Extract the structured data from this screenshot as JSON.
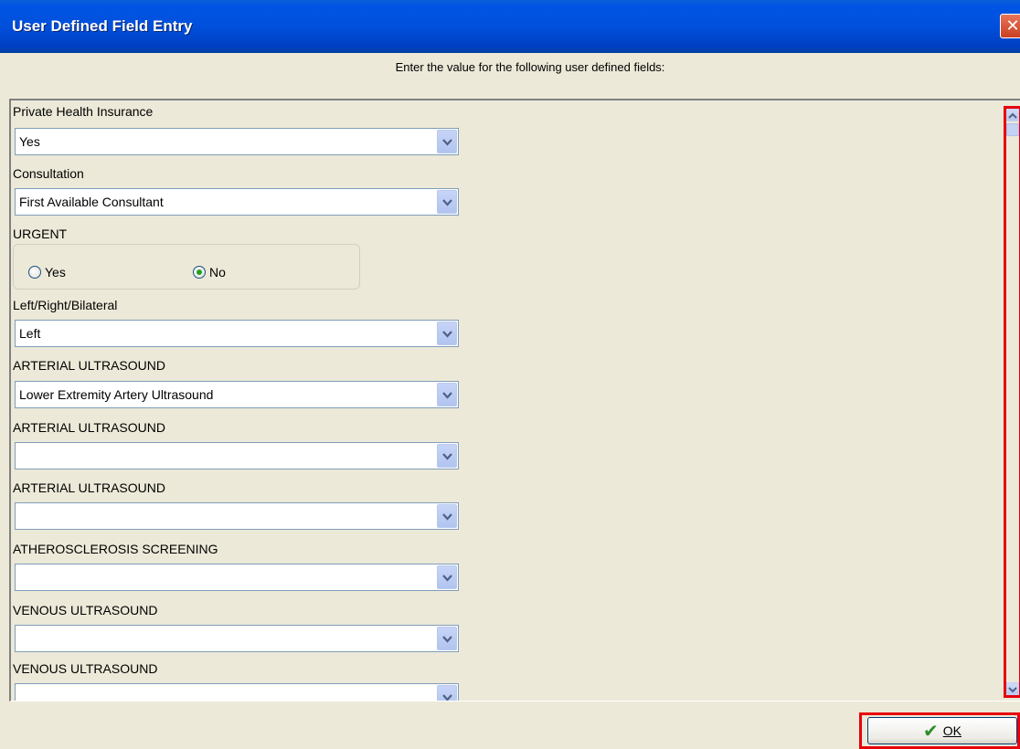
{
  "window": {
    "title": "User Defined Field Entry",
    "close_glyph": "✕"
  },
  "instruction": "Enter the value for the following user defined fields:",
  "fields": [
    {
      "label": "Private Health Insurance",
      "type": "dropdown",
      "value": "Yes"
    },
    {
      "label": "Consultation",
      "type": "dropdown",
      "value": "First Available Consultant"
    },
    {
      "label": "URGENT",
      "type": "radio",
      "options": [
        "Yes",
        "No"
      ],
      "selected": "No"
    },
    {
      "label": "Left/Right/Bilateral",
      "type": "dropdown",
      "value": "Left"
    },
    {
      "label": "ARTERIAL ULTRASOUND",
      "type": "dropdown",
      "value": "Lower Extremity Artery Ultrasound"
    },
    {
      "label": "ARTERIAL ULTRASOUND",
      "type": "dropdown",
      "value": ""
    },
    {
      "label": "ARTERIAL ULTRASOUND",
      "type": "dropdown",
      "value": ""
    },
    {
      "label": "ATHEROSCLEROSIS SCREENING",
      "type": "dropdown",
      "value": ""
    },
    {
      "label": "VENOUS ULTRASOUND",
      "type": "dropdown",
      "value": ""
    },
    {
      "label": "VENOUS ULTRASOUND",
      "type": "dropdown",
      "value": ""
    }
  ],
  "icons": {
    "dropdown": "chevron-down-icon",
    "close": "close-icon",
    "ok": "checkmark-icon"
  },
  "footer": {
    "ok_label": "OK",
    "ok_glyph": "✔"
  },
  "colors": {
    "titlebar": "#0054E3",
    "highlight": "#E8000C",
    "dialog_bg": "#ECE9D8"
  }
}
